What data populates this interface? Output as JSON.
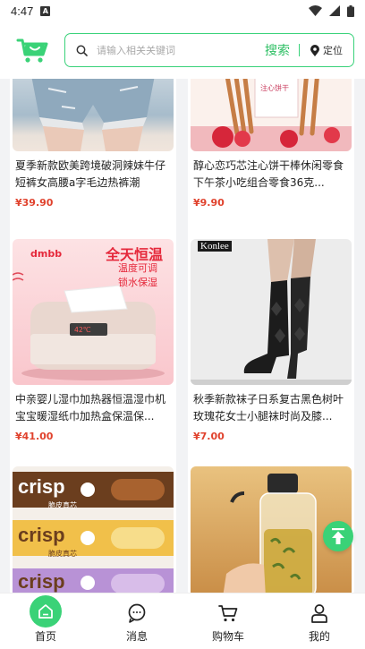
{
  "status_bar": {
    "time": "4:47",
    "notification_icon": "A"
  },
  "search": {
    "placeholder": "请输入相关关键词",
    "button_label": "搜索",
    "location_label": "定位"
  },
  "products": [
    {
      "title": "夏季新款欧美跨境破洞辣妹牛仔短裤女高腰a字毛边热裤潮",
      "price": "¥39.90",
      "image": "denim-shorts"
    },
    {
      "title": "醇心恋巧芯注心饼干棒休闲零食下午茶小吃组合零食36克...",
      "price": "¥9.90",
      "image": "strawberry-biscuit-sticks",
      "image_text": "注心饼干"
    },
    {
      "title": "中亲婴儿湿巾加热器恒温湿巾机宝宝暖湿纸巾加热盒保温保...",
      "price": "¥41.00",
      "image": "wipes-warmer",
      "image_brand": "dmbb",
      "image_headline": "全天恒温",
      "image_sub1": "温度可调",
      "image_sub2": "锁水保湿"
    },
    {
      "title": "秋季新款袜子日系复古黑色树叶玫瑰花女士小腿袜时尚及膝...",
      "price": "¥7.00",
      "image": "knee-socks",
      "image_brand": "Konlee"
    },
    {
      "title": "",
      "price": "",
      "image": "crisp-wafer",
      "image_text": "crisp",
      "image_sub": "脆皮真芯"
    },
    {
      "title": "",
      "price": "",
      "image": "glass-tea-bottle"
    }
  ],
  "tabbar": [
    {
      "label": "首页",
      "icon": "home-icon",
      "active": true
    },
    {
      "label": "消息",
      "icon": "message-icon"
    },
    {
      "label": "购物车",
      "icon": "cart-icon"
    },
    {
      "label": "我的",
      "icon": "profile-icon"
    }
  ],
  "colors": {
    "accent": "#3ad277",
    "price": "#e0422d"
  }
}
